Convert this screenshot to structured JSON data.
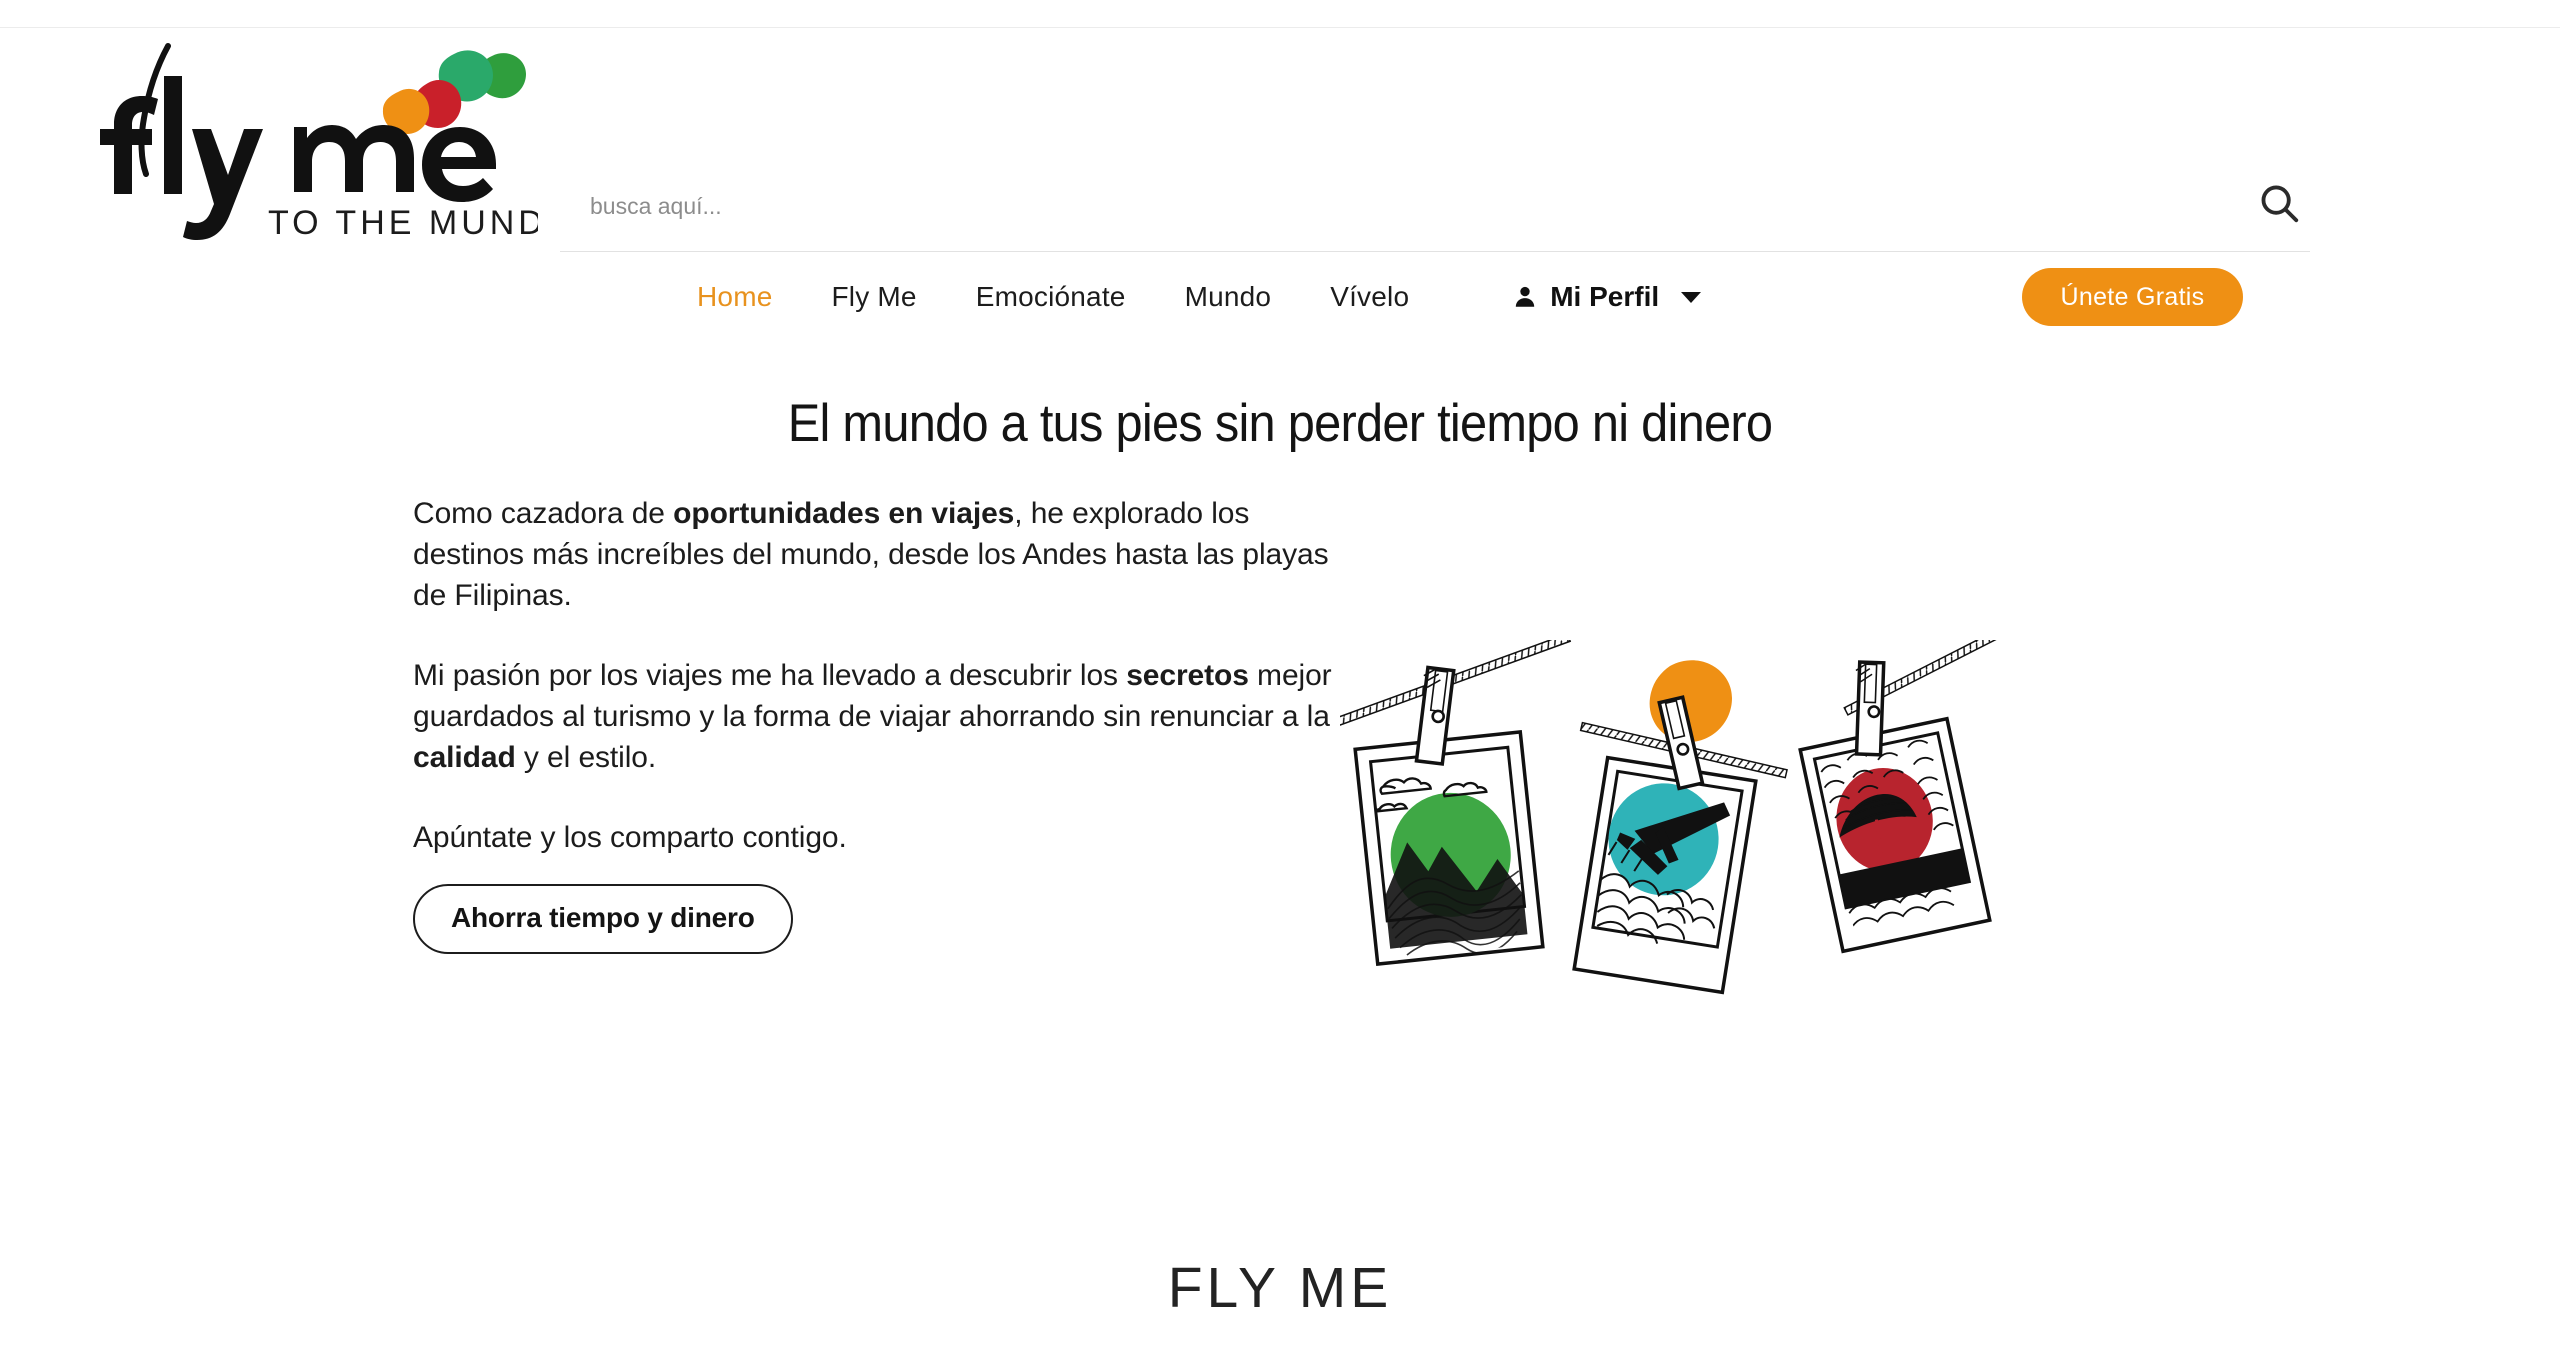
{
  "brand": {
    "logo_line1": "fly me",
    "logo_line2": "TO THE MUNDO",
    "accent_orange": "#ef9014",
    "blob_green": "#2aa96a",
    "blob_green_dark": "#2f9e3d",
    "blob_red": "#c9202a",
    "blob_orange": "#ef9014",
    "blob_teal": "#2fb3b8"
  },
  "search": {
    "placeholder": "busca aquí...",
    "value": "",
    "icon": "search-icon"
  },
  "nav": {
    "items": [
      {
        "label": "Home",
        "active": true
      },
      {
        "label": "Fly Me",
        "active": false
      },
      {
        "label": "Emociónate",
        "active": false
      },
      {
        "label": "Mundo",
        "active": false
      },
      {
        "label": "Vívelo",
        "active": false
      }
    ],
    "profile": {
      "label": "Mi Perfil",
      "icon": "user-icon",
      "caret": "chevron-down-icon"
    },
    "cta_label": "Únete Gratis"
  },
  "hero": {
    "title": "El mundo a tus pies sin perder tiempo ni dinero",
    "paragraph1_a": "Como cazadora de ",
    "paragraph1_b": "oportunidades en viajes",
    "paragraph1_c": ", he explorado los destinos más increíbles del mundo, desde los Andes hasta las playas de Filipinas.",
    "paragraph2_a": "Mi pasión por los viajes me ha llevado a descubrir los ",
    "paragraph2_b": "secretos",
    "paragraph2_c": " mejor guardados al turismo y la forma de viajar ahorrando sin renunciar a la ",
    "paragraph2_d": "calidad",
    "paragraph2_e": " y el estilo.",
    "paragraph3": "Apúntate y los comparto contigo.",
    "button_label": "Ahorra tiempo y dinero",
    "illustration": "hanging-polaroid-photos-illustration"
  },
  "footer": {
    "brand": "FLY ME"
  }
}
